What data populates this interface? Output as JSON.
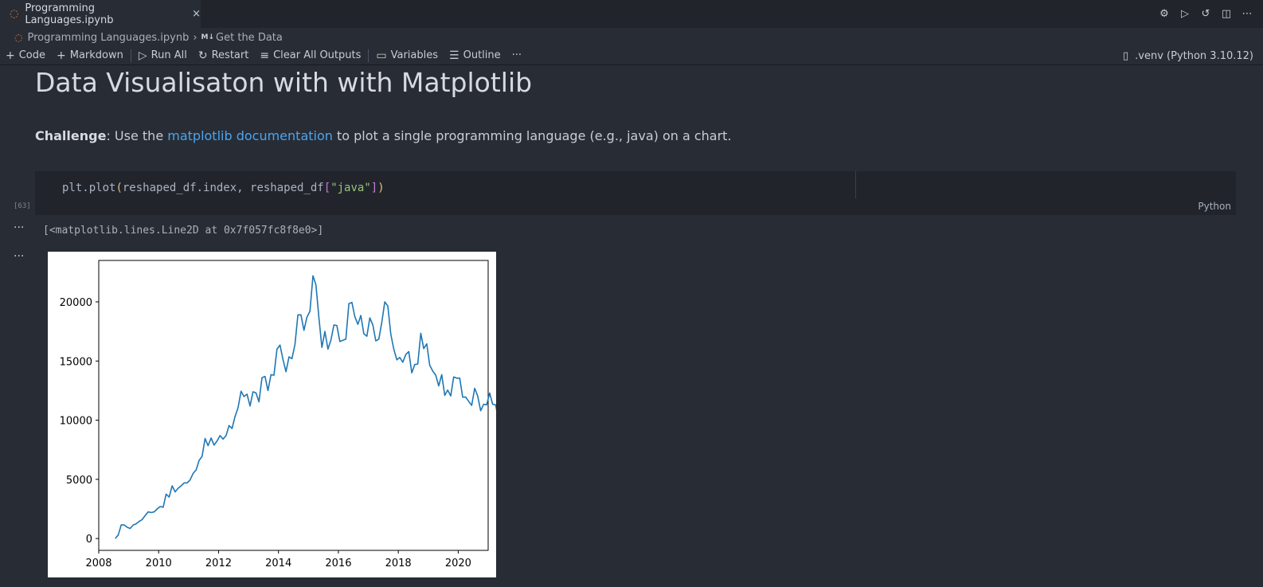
{
  "tab": {
    "title": "Programming Languages.ipynb",
    "close_icon": "×"
  },
  "breadcrumb": {
    "file": "Programming Languages.ipynb",
    "section_badge": "M↓",
    "section": "Get the Data"
  },
  "toolbar": {
    "code_label": "Code",
    "markdown_label": "Markdown",
    "run_all_label": "Run All",
    "restart_label": "Restart",
    "clear_outputs_label": "Clear All Outputs",
    "variables_label": "Variables",
    "outline_label": "Outline",
    "more_label": "···"
  },
  "kernel": {
    "label": ".venv (Python 3.10.12)"
  },
  "markdown": {
    "heading": "Data Visualisaton with with Matplotlib",
    "challenge_bold": "Challenge",
    "challenge_pre": ": Use the ",
    "challenge_link": "matplotlib documentation",
    "challenge_post": " to plot a single programming language (e.g., java) on a chart."
  },
  "code_cell": {
    "execution_count": "[63]",
    "language": "Python",
    "tokens": {
      "fn": "plt.plot",
      "open": "(",
      "args": "reshaped_df.index, reshaped_df",
      "lbrk": "[",
      "str": "\"java\"",
      "rbrk": "]",
      "close": ")"
    }
  },
  "output": {
    "text": "[<matplotlib.lines.Line2D at 0x7f057fc8f8e0>]",
    "more1": "···",
    "more2": "···"
  },
  "colors": {
    "line": "#1f77b4",
    "link": "#4aa5f0",
    "accent": "#e37933"
  },
  "chart_data": {
    "type": "line",
    "xlim": [
      2008.0,
      2021.0
    ],
    "ylim": [
      -1000,
      23500
    ],
    "xticks": [
      2008,
      2010,
      2012,
      2014,
      2016,
      2018,
      2020
    ],
    "yticks": [
      0,
      5000,
      10000,
      15000,
      20000
    ],
    "series": [
      {
        "points": [
          [
            2008.55,
            0
          ],
          [
            2008.65,
            300
          ],
          [
            2008.75,
            1150
          ],
          [
            2008.85,
            1150
          ],
          [
            2008.95,
            950
          ],
          [
            2009.05,
            850
          ],
          [
            2009.15,
            1150
          ],
          [
            2009.25,
            1250
          ],
          [
            2009.35,
            1450
          ],
          [
            2009.45,
            1600
          ],
          [
            2009.55,
            1950
          ],
          [
            2009.65,
            2250
          ],
          [
            2009.75,
            2200
          ],
          [
            2009.85,
            2250
          ],
          [
            2009.95,
            2500
          ],
          [
            2010.05,
            2700
          ],
          [
            2010.15,
            2650
          ],
          [
            2010.25,
            3750
          ],
          [
            2010.35,
            3500
          ],
          [
            2010.45,
            4450
          ],
          [
            2010.55,
            3950
          ],
          [
            2010.65,
            4250
          ],
          [
            2010.75,
            4450
          ],
          [
            2010.85,
            4700
          ],
          [
            2010.95,
            4700
          ],
          [
            2011.05,
            4950
          ],
          [
            2011.15,
            5500
          ],
          [
            2011.25,
            5800
          ],
          [
            2011.35,
            6600
          ],
          [
            2011.45,
            6950
          ],
          [
            2011.55,
            8450
          ],
          [
            2011.65,
            7850
          ],
          [
            2011.75,
            8500
          ],
          [
            2011.85,
            7900
          ],
          [
            2011.95,
            8250
          ],
          [
            2012.05,
            8700
          ],
          [
            2012.15,
            8400
          ],
          [
            2012.25,
            8700
          ],
          [
            2012.35,
            9550
          ],
          [
            2012.45,
            9300
          ],
          [
            2012.55,
            10300
          ],
          [
            2012.65,
            11050
          ],
          [
            2012.75,
            12450
          ],
          [
            2012.85,
            12000
          ],
          [
            2012.95,
            12200
          ],
          [
            2013.05,
            11200
          ],
          [
            2013.15,
            12400
          ],
          [
            2013.25,
            12300
          ],
          [
            2013.35,
            11550
          ],
          [
            2013.45,
            13600
          ],
          [
            2013.55,
            13700
          ],
          [
            2013.65,
            12500
          ],
          [
            2013.75,
            13850
          ],
          [
            2013.85,
            13800
          ],
          [
            2013.95,
            16000
          ],
          [
            2014.05,
            16350
          ],
          [
            2014.15,
            15150
          ],
          [
            2014.25,
            14100
          ],
          [
            2014.35,
            15350
          ],
          [
            2014.45,
            15200
          ],
          [
            2014.55,
            16400
          ],
          [
            2014.65,
            18900
          ],
          [
            2014.75,
            18900
          ],
          [
            2014.85,
            17600
          ],
          [
            2014.95,
            18700
          ],
          [
            2015.05,
            19200
          ],
          [
            2015.15,
            22200
          ],
          [
            2015.25,
            21450
          ],
          [
            2015.35,
            18650
          ],
          [
            2015.45,
            16150
          ],
          [
            2015.55,
            17500
          ],
          [
            2015.65,
            16000
          ],
          [
            2015.75,
            16750
          ],
          [
            2015.85,
            18050
          ],
          [
            2015.95,
            18000
          ],
          [
            2016.05,
            16650
          ],
          [
            2016.15,
            16750
          ],
          [
            2016.25,
            16850
          ],
          [
            2016.35,
            19850
          ],
          [
            2016.45,
            19950
          ],
          [
            2016.55,
            18750
          ],
          [
            2016.65,
            18100
          ],
          [
            2016.75,
            18850
          ],
          [
            2016.85,
            17300
          ],
          [
            2016.95,
            17100
          ],
          [
            2017.05,
            18650
          ],
          [
            2017.15,
            18050
          ],
          [
            2017.25,
            16700
          ],
          [
            2017.35,
            16850
          ],
          [
            2017.45,
            18300
          ],
          [
            2017.55,
            20000
          ],
          [
            2017.65,
            19650
          ],
          [
            2017.75,
            17250
          ],
          [
            2017.85,
            16000
          ],
          [
            2017.95,
            15100
          ],
          [
            2018.05,
            15300
          ],
          [
            2018.15,
            14900
          ],
          [
            2018.25,
            15550
          ],
          [
            2018.35,
            15800
          ],
          [
            2018.45,
            14000
          ],
          [
            2018.55,
            14700
          ],
          [
            2018.65,
            14750
          ],
          [
            2018.75,
            17350
          ],
          [
            2018.85,
            16050
          ],
          [
            2018.95,
            16450
          ],
          [
            2019.05,
            14650
          ],
          [
            2019.15,
            14150
          ],
          [
            2019.25,
            13800
          ],
          [
            2019.35,
            12900
          ],
          [
            2019.45,
            13850
          ],
          [
            2019.55,
            12100
          ],
          [
            2019.65,
            12550
          ],
          [
            2019.75,
            12050
          ],
          [
            2019.85,
            13650
          ],
          [
            2019.95,
            13550
          ],
          [
            2020.05,
            13550
          ],
          [
            2020.15,
            11950
          ],
          [
            2020.25,
            11950
          ],
          [
            2020.35,
            11600
          ],
          [
            2020.45,
            11250
          ],
          [
            2020.55,
            12700
          ],
          [
            2020.65,
            12050
          ],
          [
            2020.75,
            10800
          ],
          [
            2020.85,
            11350
          ],
          [
            2020.95,
            11300
          ],
          [
            2021.05,
            12300
          ],
          [
            2021.15,
            11350
          ],
          [
            2021.25,
            11300
          ],
          [
            2021.35,
            9950
          ],
          [
            2021.45,
            11050
          ],
          [
            2021.55,
            9700
          ],
          [
            2021.65,
            11550
          ],
          [
            2021.75,
            13150
          ],
          [
            2021.85,
            12300
          ],
          [
            2021.95,
            10600
          ],
          [
            2022.05,
            11650
          ]
        ]
      }
    ]
  }
}
